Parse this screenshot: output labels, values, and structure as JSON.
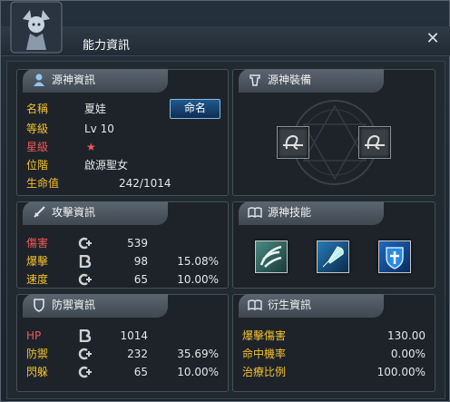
{
  "window": {
    "title": "能力資訊",
    "close": "✕"
  },
  "info": {
    "header": "源神資訊",
    "rename_button": "命名",
    "rows": [
      {
        "label": "名稱",
        "value": "夏娃"
      },
      {
        "label": "等級",
        "value": "Lv 10"
      },
      {
        "label": "星級",
        "value": "★"
      },
      {
        "label": "位階",
        "value": "啟源聖女"
      },
      {
        "label": "生命值",
        "value": "242/1014"
      }
    ]
  },
  "equipment": {
    "header": "源神裝備"
  },
  "attack": {
    "header": "攻擊資訊",
    "rows": [
      {
        "label": "傷害",
        "grade": "C+",
        "value": "539",
        "percent": ""
      },
      {
        "label": "爆擊",
        "grade": "B",
        "value": "98",
        "percent": "15.08%"
      },
      {
        "label": "速度",
        "grade": "C+",
        "value": "65",
        "percent": "10.00%"
      }
    ]
  },
  "skills": {
    "header": "源神技能",
    "items": [
      "skill-claw",
      "skill-feather",
      "skill-shield"
    ]
  },
  "defense": {
    "header": "防禦資訊",
    "rows": [
      {
        "label": "HP",
        "grade": "B",
        "value": "1014",
        "percent": ""
      },
      {
        "label": "防禦",
        "grade": "C+",
        "value": "232",
        "percent": "35.69%"
      },
      {
        "label": "閃躲",
        "grade": "C+",
        "value": "65",
        "percent": "10.00%"
      }
    ]
  },
  "derived": {
    "header": "衍生資訊",
    "rows": [
      {
        "label": "爆擊傷害",
        "value": "130.00"
      },
      {
        "label": "命中機率",
        "value": "0.00%"
      },
      {
        "label": "治療比例",
        "value": "100.00%"
      }
    ]
  },
  "colors": {
    "label": "#f4c030",
    "red_label": "#f05858",
    "accent": "#1f5a90"
  }
}
